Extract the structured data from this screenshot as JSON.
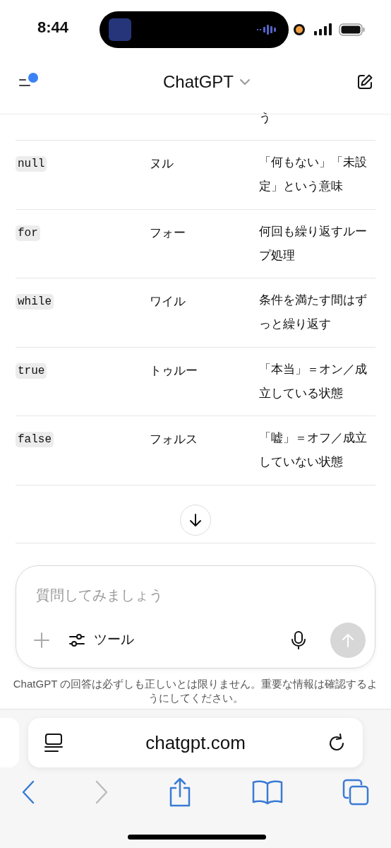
{
  "status_bar": {
    "time": "8:44"
  },
  "header": {
    "title": "ChatGPT",
    "unread_dot": true
  },
  "partial_row": {
    "meaning_tail": "う"
  },
  "rows": [
    {
      "code": "null",
      "reading": "ヌル",
      "meaning": "「何もない」「未設定」という意味"
    },
    {
      "code": "for",
      "reading": "フォー",
      "meaning": "何回も繰り返すループ処理"
    },
    {
      "code": "while",
      "reading": "ワイル",
      "meaning": "条件を満たす間はずっと繰り返す"
    },
    {
      "code": "true",
      "reading": "トゥルー",
      "meaning": "「本当」＝オン／成立している状態"
    },
    {
      "code": "false",
      "reading": "フォルス",
      "meaning": "「嘘」＝オフ／成立していない状態"
    }
  ],
  "composer": {
    "placeholder": "質問してみましょう",
    "tools_label": "ツール",
    "send_disabled": true
  },
  "disclaimer": "ChatGPT の回答は必ずしも正しいとは限りません。重要な情報は確認するようにしてください。",
  "browser": {
    "url": "chatgpt.com",
    "forward_disabled": true
  }
}
